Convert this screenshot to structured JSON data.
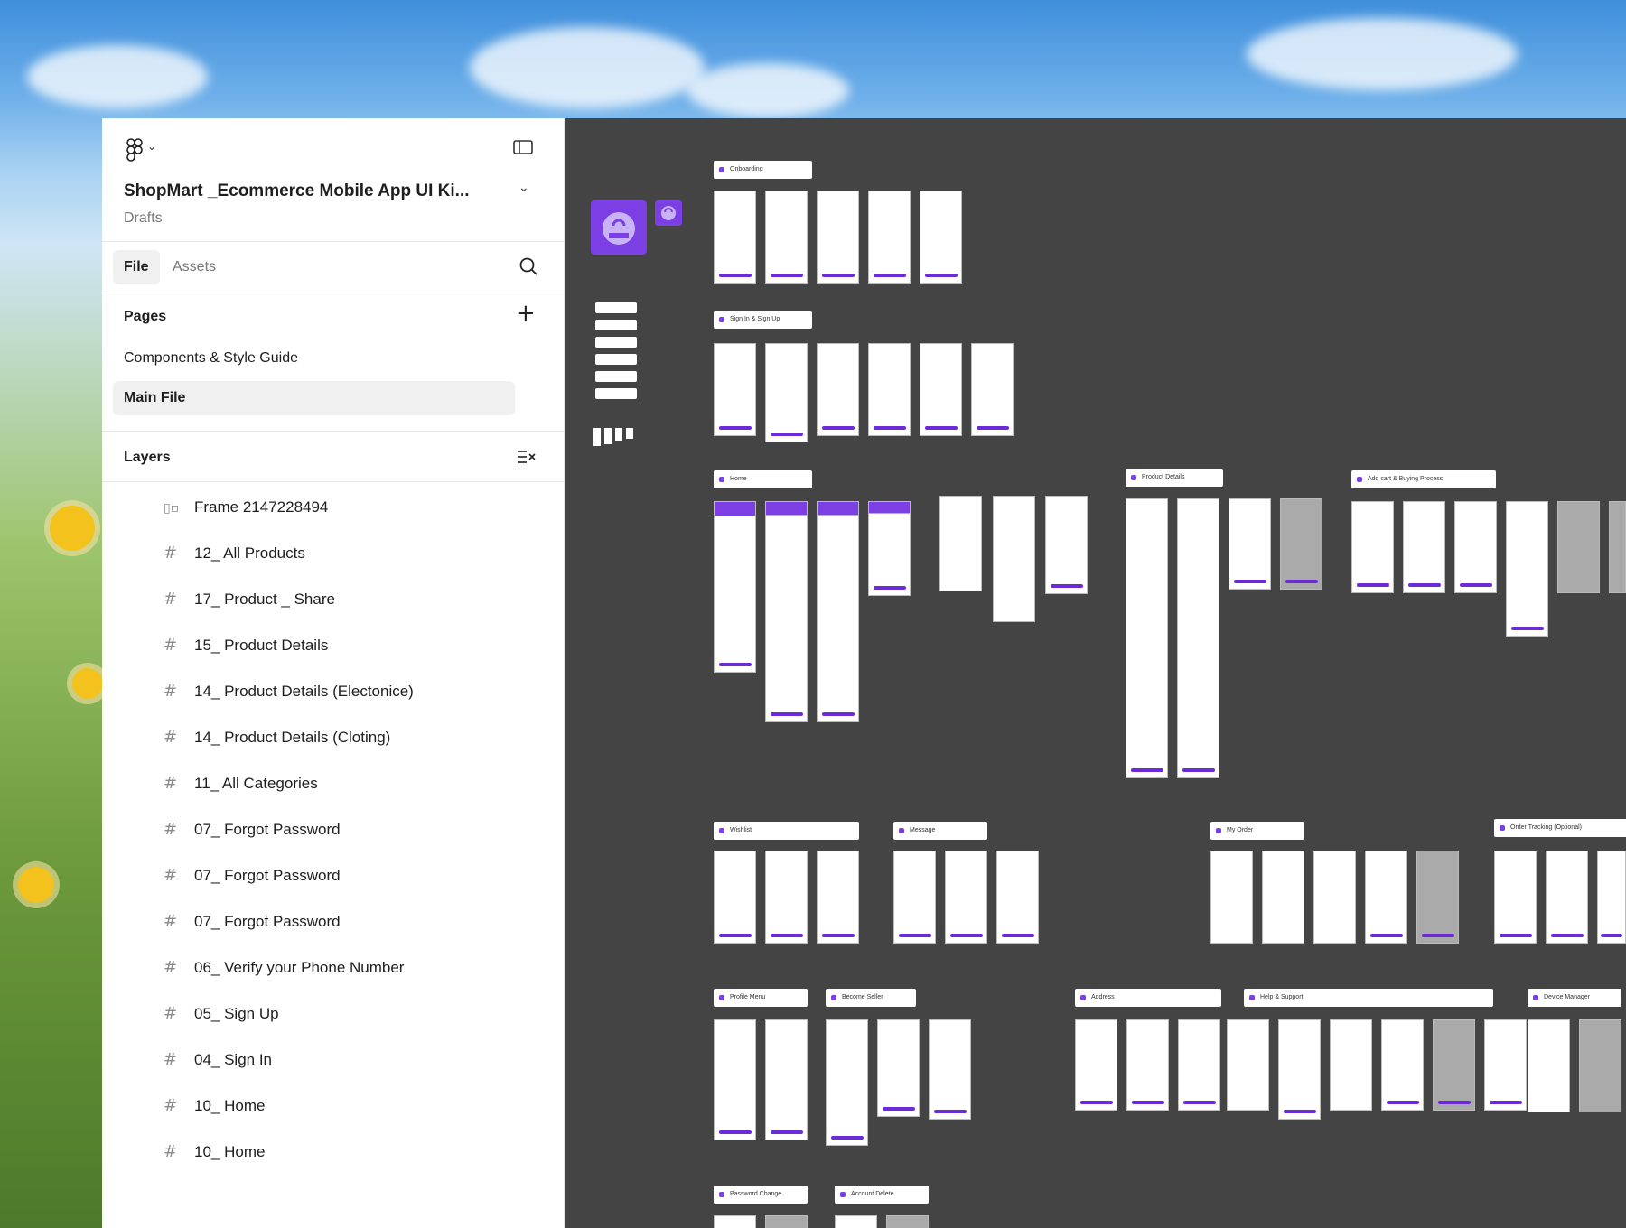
{
  "file": {
    "title": "ShopMart _Ecommerce Mobile App UI Ki...",
    "location": "Drafts"
  },
  "tabs": {
    "file": "File",
    "assets": "Assets"
  },
  "pages": {
    "header": "Pages",
    "items": [
      "Components & Style Guide",
      "Main File"
    ],
    "selected": "Main File"
  },
  "layers": {
    "header": "Layers",
    "items": [
      {
        "label": "Frame 2147228494",
        "icon": "frame-slot-icon"
      },
      {
        "label": "12_ All Products",
        "icon": "frame-hash-icon"
      },
      {
        "label": "17_ Product _ Share",
        "icon": "frame-hash-icon"
      },
      {
        "label": "15_ Product Details",
        "icon": "frame-hash-icon"
      },
      {
        "label": "14_ Product Details (Electonice)",
        "icon": "frame-hash-icon"
      },
      {
        "label": "14_ Product Details (Cloting)",
        "icon": "frame-hash-icon"
      },
      {
        "label": "11_ All Categories",
        "icon": "frame-hash-icon"
      },
      {
        "label": "07_ Forgot Password",
        "icon": "frame-hash-icon"
      },
      {
        "label": "07_ Forgot Password",
        "icon": "frame-hash-icon"
      },
      {
        "label": "07_ Forgot Password",
        "icon": "frame-hash-icon"
      },
      {
        "label": "06_ Verify your Phone Number",
        "icon": "frame-hash-icon"
      },
      {
        "label": "05_ Sign Up",
        "icon": "frame-hash-icon"
      },
      {
        "label": "04_ Sign In",
        "icon": "frame-hash-icon"
      },
      {
        "label": "10_ Home",
        "icon": "frame-hash-icon"
      },
      {
        "label": "10_ Home",
        "icon": "frame-hash-icon"
      }
    ]
  },
  "canvas": {
    "sections": [
      "Onboarding",
      "Sign In & Sign Up",
      "Home",
      "Product Details",
      "Add cart & Buying Process",
      "Wishlist",
      "Message",
      "My Order",
      "Order Tracking (Optional)",
      "Profile Menu",
      "Become Seller",
      "Address",
      "Help & Support",
      "Device Manager",
      "Password Change",
      "Account Delete"
    ]
  },
  "colors": {
    "accent": "#6c2bd9",
    "canvas_bg": "#444444",
    "panel_bg": "#ffffff",
    "selected_page_bg": "#f0f0f0"
  }
}
